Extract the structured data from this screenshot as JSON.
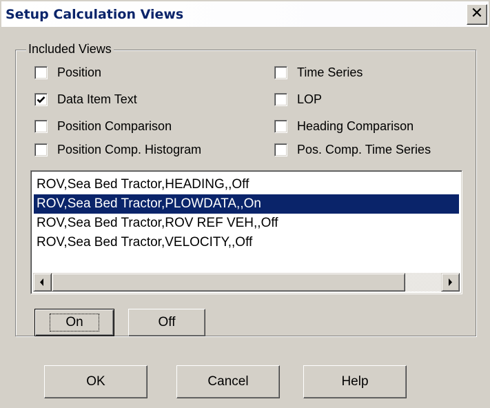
{
  "window": {
    "title": "Setup Calculation Views",
    "close_glyph": "✕"
  },
  "group": {
    "legend": "Included Views",
    "checkboxes": [
      {
        "label": "Position",
        "checked": false
      },
      {
        "label": "Time Series",
        "checked": false
      },
      {
        "label": "Data Item Text",
        "checked": true
      },
      {
        "label": "LOP",
        "checked": false
      },
      {
        "label": "Position Comparison",
        "checked": false
      },
      {
        "label": "Heading Comparison",
        "checked": false
      },
      {
        "label": "Position Comp. Histogram",
        "checked": false
      },
      {
        "label": "Pos. Comp. Time Series",
        "checked": false
      }
    ],
    "list": {
      "items": [
        "ROV,Sea Bed Tractor,HEADING,,Off",
        "ROV,Sea Bed Tractor,PLOWDATA,,On",
        "ROV,Sea Bed Tractor,ROV REF VEH,,Off",
        "ROV,Sea Bed Tractor,VELOCITY,,Off"
      ],
      "selected_index": 1
    },
    "on_label": "On",
    "off_label": "Off"
  },
  "footer": {
    "ok_label": "OK",
    "cancel_label": "Cancel",
    "help_label": "Help"
  },
  "colors": {
    "face": "#d4d0c8",
    "selection": "#0a246a",
    "title_text": "#0a246a"
  },
  "icons": {
    "close": "close-icon",
    "check": "check-icon",
    "scroll_left": "arrow-left-icon",
    "scroll_right": "arrow-right-icon"
  }
}
